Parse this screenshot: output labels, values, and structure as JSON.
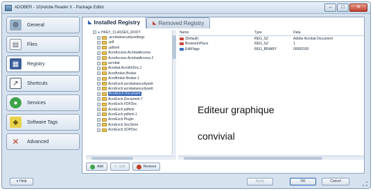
{
  "window": {
    "title": "ADOBER - 10|Adobe Reader X - Package Editor"
  },
  "sidebar": {
    "items": [
      {
        "label": "General",
        "icon": "wrench-icon"
      },
      {
        "label": "Files",
        "icon": "files-icon"
      },
      {
        "label": "Registry",
        "icon": "registry-icon"
      },
      {
        "label": "Shortcuts",
        "icon": "shortcuts-icon"
      },
      {
        "label": "Services",
        "icon": "services-icon"
      },
      {
        "label": "Software Tags",
        "icon": "tag-icon"
      },
      {
        "label": "Advanced",
        "icon": "tools-icon"
      }
    ],
    "active": "Registry"
  },
  "tabs": [
    {
      "label": "Installed Registry"
    },
    {
      "label": "Removed Registry"
    }
  ],
  "tree": {
    "root": "HKEY_CLASSES_ROOT",
    "items": [
      ".acrobatsecuritysettings",
      ".pdf",
      ".pdfxml",
      "AcroAccess.AcrobatAccess",
      "AcroAccess.AcrobatAccess.2",
      "acrobat",
      "Acrobat.AcroAXDoc.1",
      "AcroBroker.Broker",
      "AcroBroker.Broker.1",
      "AcroExch.acrobatsecuritysett",
      "AcroExch.acrobatsecuritysett",
      "AcroExch.Document",
      "AcroExch.Document.7",
      "AcroExch.FDFDoc",
      "AcroExch.pdfxml",
      "AcroExch.pdfxml.1",
      "AcroExch.Plugin",
      "AcroExch.SecStore",
      "AcroExch.XDPDoc"
    ],
    "selected": "AcroExch.Document"
  },
  "list": {
    "columns": [
      "Name",
      "Type",
      "Data"
    ],
    "rows": [
      {
        "name": "(Default)",
        "type": "REG_SZ",
        "data": "Adobe Acrobat Document",
        "icon": "string-value-icon"
      },
      {
        "name": "BrowseInPlace",
        "type": "REG_SZ",
        "data": "1",
        "icon": "string-value-icon"
      },
      {
        "name": "EditFlags",
        "type": "REG_BINARY",
        "data": "00000100",
        "icon": "binary-value-icon"
      }
    ]
  },
  "overlay": {
    "line1": "Editeur graphique",
    "line2": "convivial"
  },
  "actions": {
    "add": "Add",
    "edit": "Edit",
    "remove": "Remove"
  },
  "footer": {
    "help": "Help",
    "apply": "Apply",
    "ok": "OK",
    "cancel": "Cancel"
  },
  "colors": {
    "accent": "#2d5fb0",
    "panel_bg": "#d6e2ee",
    "folder": "#e9c15a"
  }
}
